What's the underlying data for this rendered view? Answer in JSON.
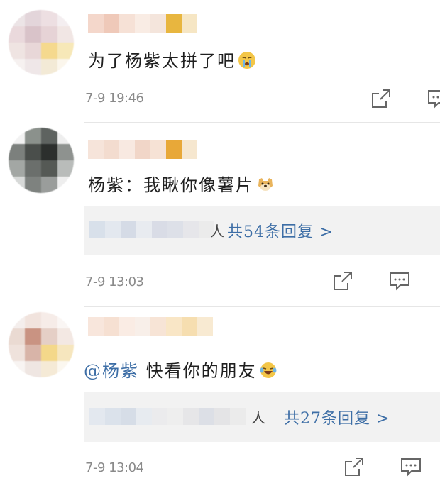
{
  "comments": [
    {
      "text": "为了杨紫太拼了吧",
      "emoji": "crying-face-icon",
      "timestamp": "7-9 19:46"
    },
    {
      "text": "杨紫：我瞅你像薯片",
      "emoji": "doge-face-icon",
      "replies": {
        "tail": "人",
        "link": "共54条回复 >"
      },
      "timestamp": "7-9 13:03"
    },
    {
      "mention": "@杨紫",
      "text": " 快看你的朋友",
      "emoji": "laughing-tears-icon",
      "replies": {
        "tail": "人",
        "link": "共27条回复 >"
      },
      "timestamp": "7-9 13:04"
    }
  ],
  "colors": {
    "link": "#3d6ea6",
    "timestamp": "#8a8a8a",
    "reply_bg": "#f2f2f2"
  }
}
